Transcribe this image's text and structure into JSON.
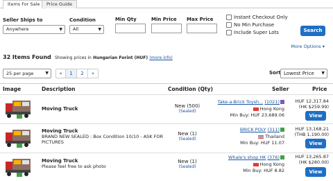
{
  "tabs": [
    {
      "label": "Items For Sale"
    },
    {
      "label": "Price Guide"
    }
  ],
  "filters": {
    "ships_to_label": "Seller Ships to",
    "ships_to_value": "Anywhere",
    "condition_label": "Condition",
    "condition_value": "All",
    "min_qty_label": "Min Qty",
    "min_price_label": "Min Price",
    "max_price_label": "Max Price",
    "checkboxes": [
      {
        "label": "Instant Checkout Only"
      },
      {
        "label": "No Min Purchase"
      },
      {
        "label": "Include Super Lots"
      }
    ],
    "search_label": "Search",
    "more_options": "More Options ▾"
  },
  "summary": {
    "count": "32 Items Found",
    "showing": "Showing prices in",
    "currency": "Hungarian Forint (HUF)",
    "more_info": "(more info)"
  },
  "pagination": {
    "per_page": "25 per page",
    "prev": "«",
    "pages": [
      "1",
      "2"
    ],
    "next": "»",
    "sort_label": "Sort",
    "sort_value": "Lowest Price"
  },
  "table": {
    "headers": {
      "image": "Image",
      "description": "Description",
      "condition": "Condition (Qty)",
      "seller": "Seller",
      "price": "Price"
    },
    "rows": [
      {
        "title": "Moving Truck",
        "desc": "",
        "cond": "New (500)",
        "sealed": "(Sealed)",
        "seller": "Take-a-Brick Toysh...",
        "feedback": "(1021)",
        "country": "Hong Kong",
        "min_buy": "Min Buy: HUF 23,689.06",
        "price": "HUF 12,317.84",
        "orig": "(HK $259.99)",
        "view": "View"
      },
      {
        "title": "Moving Truck",
        "desc": "BRAND NEW SEALED : Box Condition 10/10 - ASK FOR PICTURES",
        "cond": "New (1)",
        "sealed": "(Sealed)",
        "seller": "BRICK POLY",
        "feedback": "(311)",
        "country": "Thailand",
        "min_buy": "Min Buy: HUF 11.07",
        "price": "HUF 13,168.21",
        "orig": "(THB 1,190.00)",
        "view": "View"
      },
      {
        "title": "Moving Truck",
        "desc": "Please feel free to ask photo",
        "cond": "New (1)",
        "sealed": "(Sealed)",
        "seller": "Whale's shop HK",
        "feedback": "(376)",
        "country": "Hong Kong",
        "min_buy": "Min Buy: HUF 8.82",
        "price": "HUF 13,265.87",
        "orig": "(HK $280.00)",
        "view": "View"
      }
    ]
  }
}
